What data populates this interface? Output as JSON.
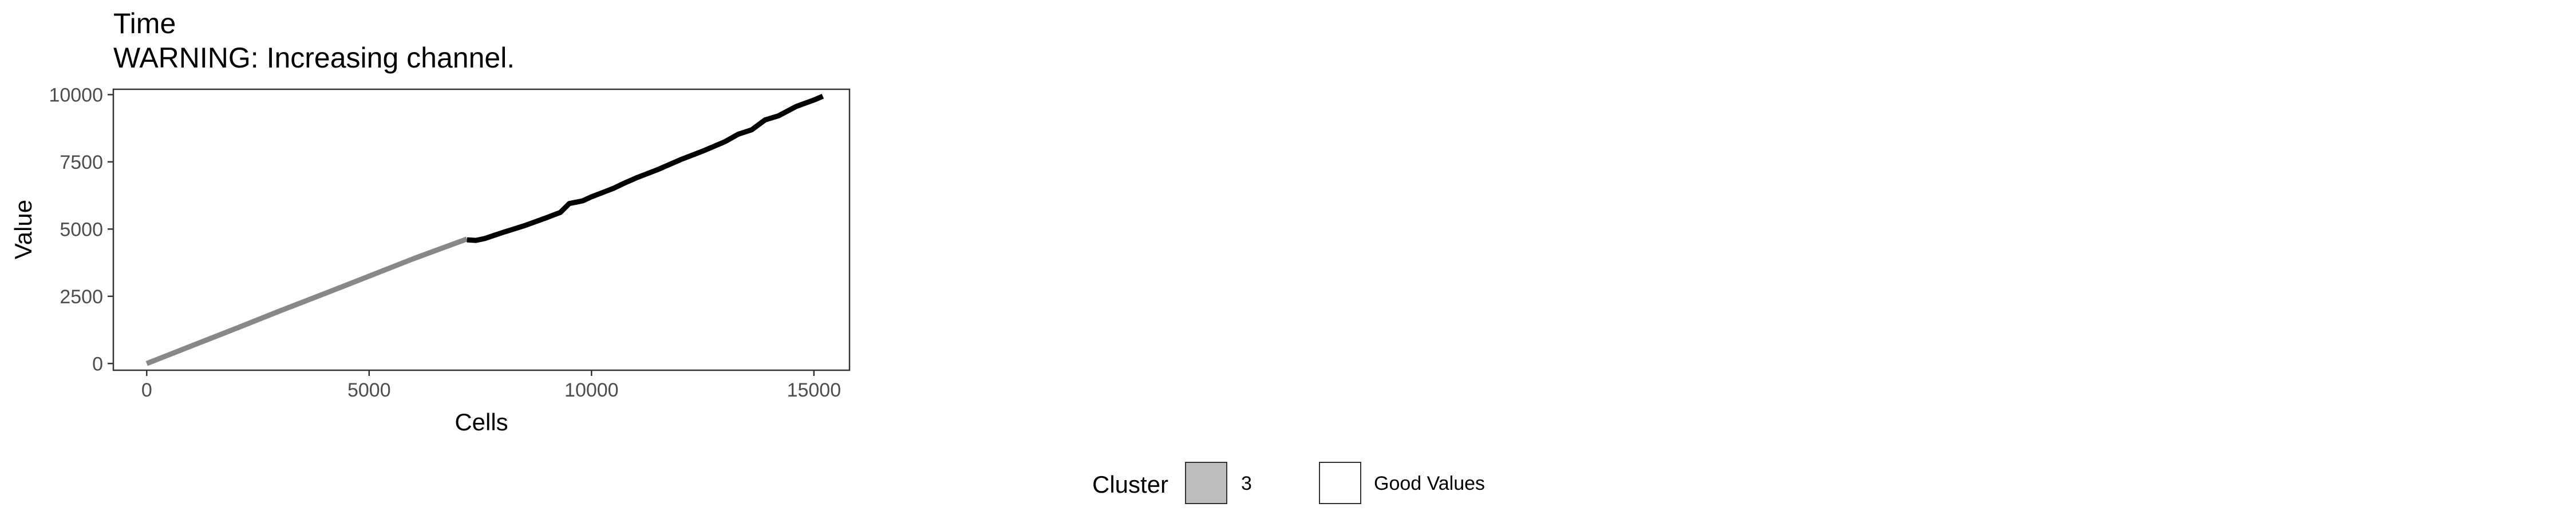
{
  "chart_data": {
    "type": "line",
    "title": "Time",
    "subtitle": "WARNING: Increasing channel.",
    "xlabel": "Cells",
    "ylabel": "Value",
    "xlim": [
      -750,
      15800
    ],
    "ylim": [
      -250,
      10200
    ],
    "x_ticks": [
      0,
      5000,
      10000,
      15000
    ],
    "y_ticks": [
      0,
      2500,
      5000,
      7500,
      10000
    ],
    "x_tick_labels": [
      "0",
      "5000",
      "10000",
      "15000"
    ],
    "y_tick_labels": [
      "0",
      "2500",
      "5000",
      "7500",
      "10000"
    ],
    "grid": false,
    "legend_position": "bottom",
    "series": [
      {
        "color": "#888888",
        "x": [
          0,
          1000,
          2000,
          3000,
          4000,
          5000,
          6000,
          7200
        ],
        "y": [
          0,
          650,
          1300,
          1960,
          2600,
          3250,
          3900,
          4630
        ]
      },
      {
        "color": "#000000",
        "x": [
          7200,
          7400,
          7600,
          8000,
          8500,
          9000,
          9300,
          9500,
          9800,
          10000,
          10500,
          10700,
          11000,
          11500,
          12000,
          12500,
          13000,
          13300,
          13600,
          13900,
          14200,
          14600,
          15000,
          15200
        ],
        "y": [
          4600,
          4580,
          4650,
          4870,
          5130,
          5430,
          5620,
          5950,
          6050,
          6200,
          6520,
          6680,
          6900,
          7220,
          7580,
          7900,
          8250,
          8530,
          8690,
          9060,
          9210,
          9560,
          9800,
          9940
        ]
      }
    ],
    "legend": {
      "title": "Cluster",
      "items": [
        {
          "label": "3",
          "fill": "#bebebe"
        },
        {
          "label": "Good Values",
          "fill": "#ffffff"
        }
      ]
    }
  }
}
